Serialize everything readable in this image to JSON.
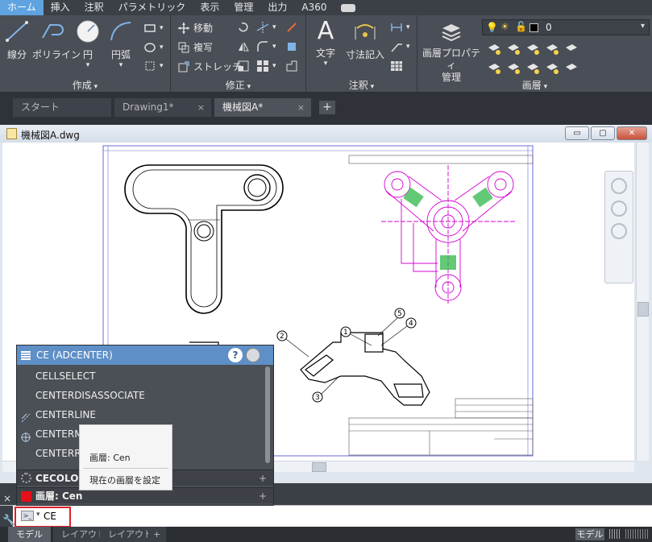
{
  "menu": {
    "tabs": [
      "ホーム",
      "挿入",
      "注釈",
      "パラメトリック",
      "表示",
      "管理",
      "出力",
      "A360"
    ]
  },
  "ribbon": {
    "draw": {
      "title": "作成",
      "buttons": [
        "線分",
        "ポリライン",
        "円",
        "円弧"
      ]
    },
    "modify": {
      "title": "修正",
      "rows": [
        "移動",
        "複写",
        "ストレッチ"
      ]
    },
    "annotation": {
      "title": "注釈",
      "buttons": [
        "文字",
        "寸法記入"
      ],
      "text_glyph": "A"
    },
    "layers": {
      "title": "画層",
      "props_button": "画層プロパティ\n管理",
      "current_layer": "0"
    }
  },
  "doc_tabs": {
    "tabs": [
      {
        "label": "スタート",
        "closable": false
      },
      {
        "label": "Drawing1*",
        "closable": true
      },
      {
        "label": "機械図A*",
        "closable": true
      }
    ],
    "new_tab": "+",
    "close_glyph": "×"
  },
  "drawing_window": {
    "title": "機械図A.dwg",
    "buttons": [
      "▭",
      "▢",
      "✕"
    ]
  },
  "autocomplete": {
    "header": "CE (ADCENTER)",
    "help": "?",
    "items": [
      "CELLSELECT",
      "CENTERDISASSOCIATE",
      "CENTERLINE",
      "CENTERMA",
      "CENTERRE"
    ],
    "sections": [
      {
        "label": "CECOLOR",
        "plus": "+"
      },
      {
        "label": "画層: Cen",
        "plus": "+"
      }
    ]
  },
  "tooltip": {
    "line1": "画層: Cen",
    "line2": "現在の画層を設定"
  },
  "command_line": {
    "value": "CE",
    "prompt_glyph": ">_"
  },
  "layout_tabs": {
    "tabs": [
      "モデル",
      "レイアウト1",
      "レイアウト2"
    ],
    "new_tab": "+",
    "status_model": "モデル"
  },
  "colors": {
    "accent": "#5fa3e0",
    "highlight_box": "#e0202a",
    "layer_swatch": "#e5101b",
    "drawing_magenta": "#d400d4",
    "hatch_green": "#2fb84a"
  }
}
